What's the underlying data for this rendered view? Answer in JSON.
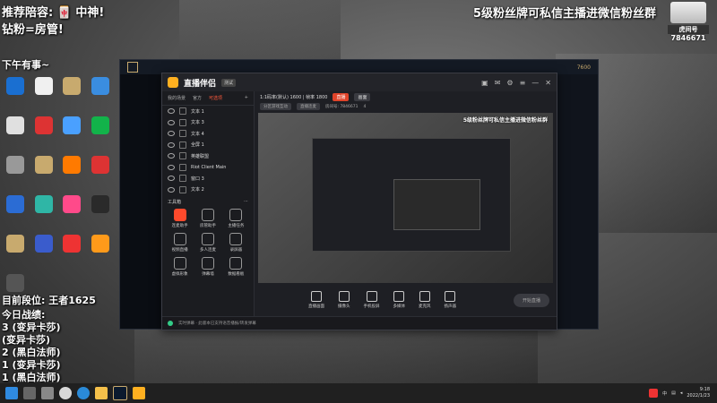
{
  "overlay": {
    "top_left_1": "推荐陪容: 🀄 中神!",
    "top_left_2": "钻粉=房管!",
    "top_left_3": "下午有事~",
    "top_right": "5级粉丝牌可私信主播进微信粉丝群",
    "room_logo_label": "虎间号",
    "room_id": "7846671",
    "bottom_left_title": "目前段位: 王者1625",
    "bottom_left_2": "今日战绩:",
    "record_lines": [
      "3 (变异卡莎)",
      "(变异卡莎)",
      "2 (黑白法师)",
      "1 (变异卡莎)",
      "1 (黑白法师)"
    ]
  },
  "desktop_icons": [
    {
      "label": "",
      "color": "#1a6fd1"
    },
    {
      "label": "",
      "color": "#f0f0f0"
    },
    {
      "label": "",
      "color": "#c8aa6e"
    },
    {
      "label": "",
      "color": "#3a8de0"
    },
    {
      "label": "",
      "color": "#e0e0e0"
    },
    {
      "label": "",
      "color": "#d33"
    },
    {
      "label": "",
      "color": "#4aa0ff"
    },
    {
      "label": "",
      "color": "#12b34a"
    },
    {
      "label": "",
      "color": "#999"
    },
    {
      "label": "",
      "color": "#c8aa6e"
    },
    {
      "label": "",
      "color": "#ff7a00"
    },
    {
      "label": "",
      "color": "#d33"
    },
    {
      "label": "",
      "color": "#2b6cd4"
    },
    {
      "label": "",
      "color": "#2fb6a6"
    },
    {
      "label": "",
      "color": "#ff4a8a"
    },
    {
      "label": "",
      "color": "#2a2a2a"
    },
    {
      "label": "",
      "color": "#c8aa6e"
    },
    {
      "label": "",
      "color": "#3a5ccc"
    },
    {
      "label": "",
      "color": "#e33"
    },
    {
      "label": "",
      "color": "#ff9a1a"
    },
    {
      "label": "",
      "color": "#555"
    }
  ],
  "game_window": {
    "tabs": [
      "",
      "",
      "",
      "",
      "7600"
    ]
  },
  "app": {
    "title": "直播伴侣",
    "title_badge": "测试",
    "left_tabs": [
      "我的场景",
      "官方",
      "可选项"
    ],
    "sources": [
      "文本 1",
      "文本 3",
      "文本 4",
      "全屏 1",
      "英雄联盟",
      "Riot Client Main",
      "窗口 3",
      "文本 2"
    ],
    "tools_header": "工具箱",
    "tools": [
      {
        "label": "连麦助手",
        "hot": true
      },
      {
        "label": "房管助手",
        "hot": false
      },
      {
        "label": "主播任务",
        "hot": false
      },
      {
        "label": "视频直播",
        "hot": false
      },
      {
        "label": "多人连麦",
        "hot": false
      },
      {
        "label": "录屏器",
        "hot": false
      },
      {
        "label": "虚拟形象",
        "hot": false
      },
      {
        "label": "弹幕墙",
        "hot": false
      },
      {
        "label": "数据看板",
        "hot": false
      }
    ],
    "info_bar": {
      "resolution": "1:1码率(默认) 1600 | 帧率 1800",
      "live_tag": "直播",
      "extra": "画面"
    },
    "info_bar2": {
      "a": "分区游戏互动",
      "b": "直播连麦",
      "c": "房间号: 7846671",
      "d": "4"
    },
    "preview_caption": "5级粉丝牌可私信主播进微信粉丝群",
    "bottom_buttons": [
      "直播画面",
      "摄像头",
      "手机投屏",
      "多媒体",
      "麦克风",
      "扬声器"
    ],
    "start_button": "开始直播",
    "status_text": "实时弹幕 · 此版本已支持语音播报/转发弹幕"
  },
  "taskbar": {
    "time": "9:18",
    "date": "2022/1/23",
    "ime": "中"
  }
}
